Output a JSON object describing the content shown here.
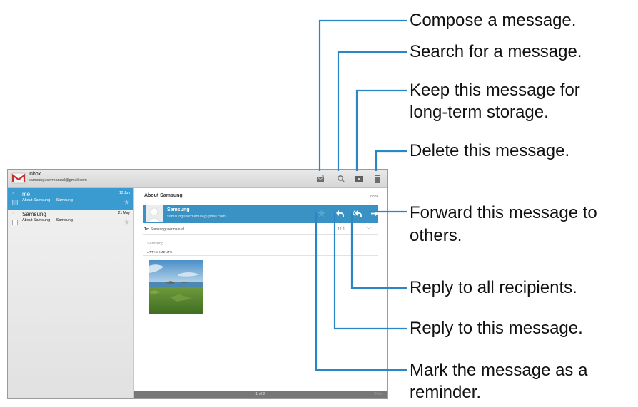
{
  "action_bar": {
    "title": "Inbox",
    "account": "samsungusermanual@gmail.com",
    "icons": [
      "compose-icon",
      "search-icon",
      "archive-icon",
      "delete-icon"
    ]
  },
  "message_list": [
    {
      "sender": "me",
      "subject": "About Samsung — Samsung",
      "date": "12 Jun",
      "selected": true
    },
    {
      "sender": "Samsung",
      "subject": "About Samsung — Samsung",
      "date": "21 May",
      "selected": false
    }
  ],
  "message": {
    "subject": "About Samsung",
    "folder": "Inbox",
    "sender_name": "Samsung",
    "sender_email": "samsungusermanual@gmail.com",
    "to_label": "To:",
    "to_value": "Samsungusermanual",
    "date_short": "12 J",
    "body": "Samsung",
    "attachments_label": "ATTACHMENTS"
  },
  "status_bar": {
    "page": "1 of 2",
    "older": "Older"
  },
  "callouts": {
    "compose": "Compose a message.",
    "search": "Search for a message.",
    "archive_line1": "Keep this message for",
    "archive_line2": "long-term storage.",
    "delete": "Delete this message.",
    "forward_line1": "Forward this message to",
    "forward_line2": "others.",
    "reply_all": "Reply to all recipients.",
    "reply": "Reply to this message.",
    "reminder_line1": "Mark the message as a",
    "reminder_line2": "reminder."
  },
  "colors": {
    "accent": "#3a9bd0",
    "sender_bar": "#3a91c4",
    "leader_line": "#2b86c5"
  }
}
